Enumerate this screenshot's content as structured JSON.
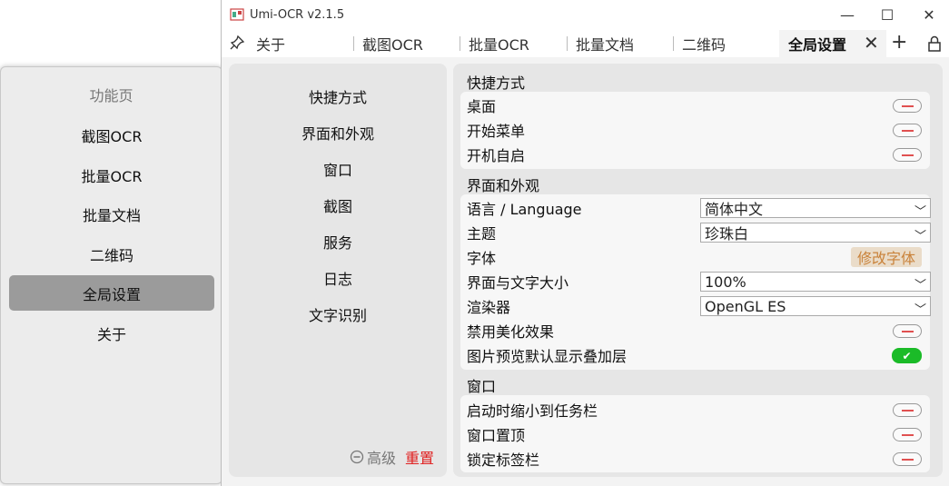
{
  "side_panel": {
    "title": "功能页",
    "items": [
      "截图OCR",
      "批量OCR",
      "批量文档",
      "二维码",
      "全局设置",
      "关于"
    ],
    "active_index": 4
  },
  "window": {
    "title": "Umi-OCR v2.1.5",
    "controls": {
      "minimize": "—",
      "maximize": "☐",
      "close": "✕"
    }
  },
  "tabs": {
    "items": [
      "关于",
      "截图OCR",
      "批量OCR",
      "批量文档",
      "二维码",
      "全局设置"
    ],
    "active_index": 5,
    "close_glyph": "✕",
    "add_glyph": "+"
  },
  "settings_nav": {
    "items": [
      "快捷方式",
      "界面和外观",
      "窗口",
      "截图",
      "服务",
      "日志",
      "文字识别"
    ],
    "advanced_label": "高级",
    "reset_label": "重置"
  },
  "sections": {
    "shortcuts": {
      "title": "快捷方式",
      "desktop": "桌面",
      "start_menu": "开始菜单",
      "autostart": "开机自启"
    },
    "appearance": {
      "title": "界面和外观",
      "language_label": "语言 / Language",
      "language_value": "简体中文",
      "theme_label": "主题",
      "theme_value": "珍珠白",
      "font_label": "字体",
      "font_button": "修改字体",
      "scale_label": "界面与文字大小",
      "scale_value": "100%",
      "renderer_label": "渲染器",
      "renderer_value": "OpenGL ES",
      "disable_effects_label": "禁用美化效果",
      "overlay_label": "图片预览默认显示叠加层",
      "overlay_on_glyph": "✔"
    },
    "window": {
      "title": "窗口",
      "minimize_on_start": "启动时缩小到任务栏",
      "always_on_top": "窗口置顶",
      "lock_tabs": "锁定标签栏"
    }
  },
  "colors": {
    "active_side": "#9b9b9b",
    "toggle_on": "#1bbb28",
    "reset": "#e02020",
    "font_button_text": "#c9823a"
  }
}
